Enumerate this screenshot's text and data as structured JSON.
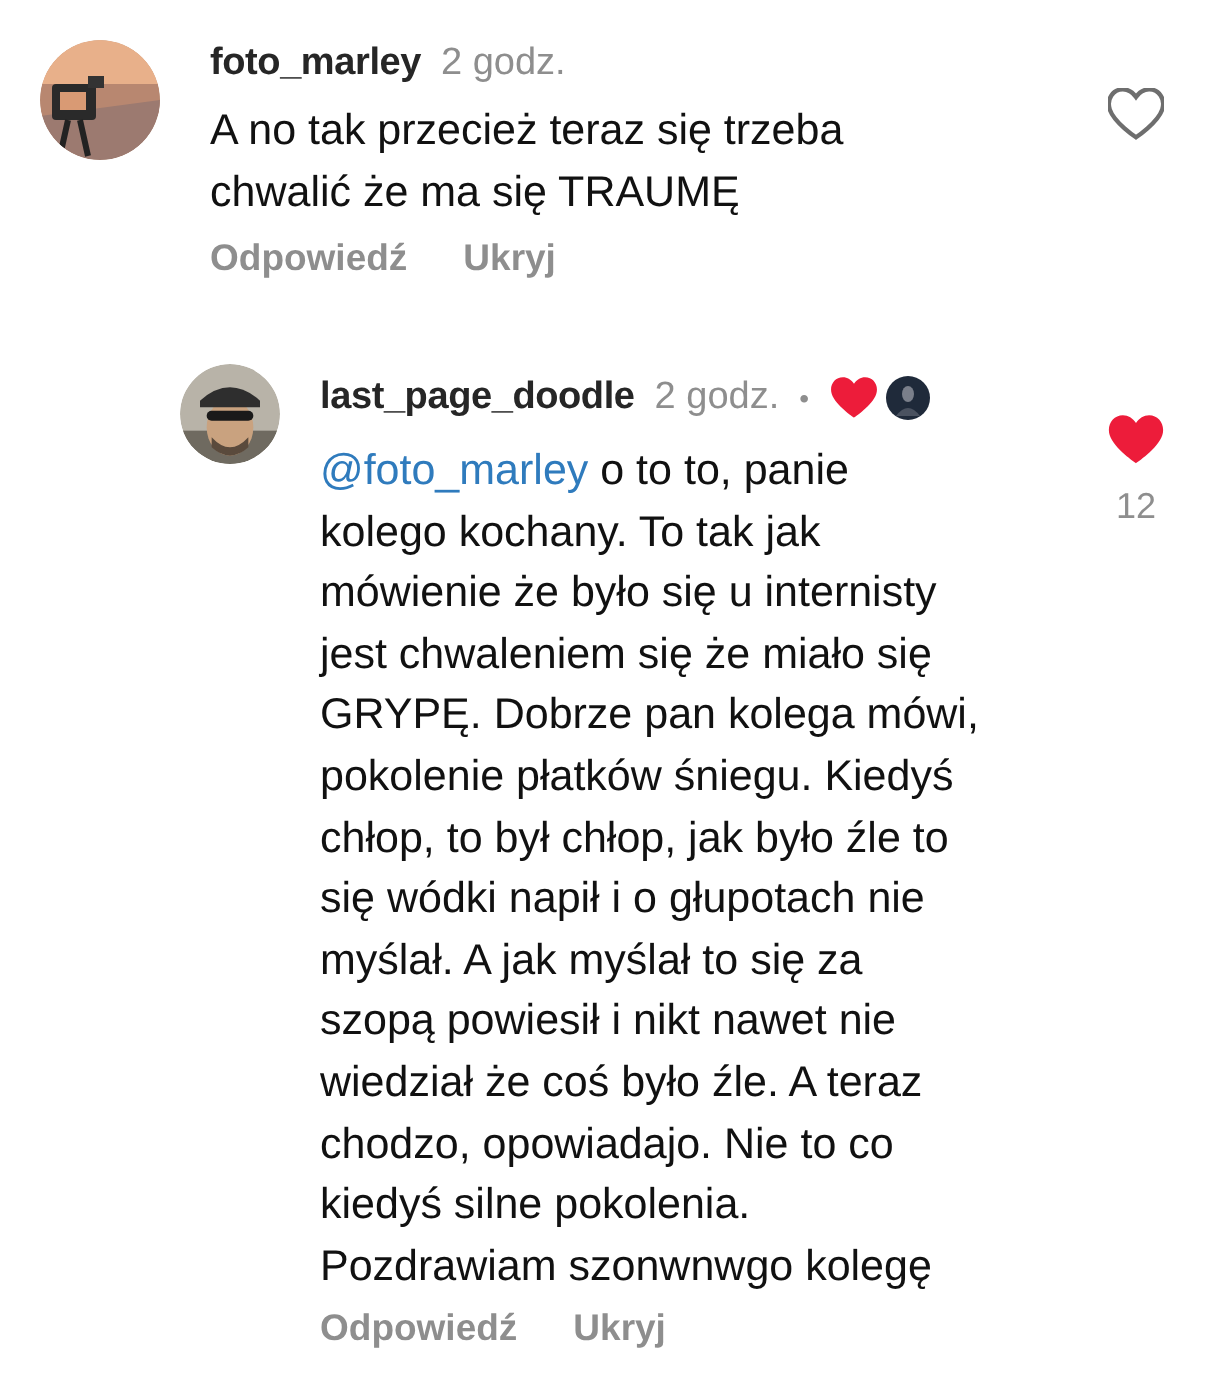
{
  "comments": [
    {
      "author": "foto_marley",
      "time": "2 godz.",
      "lines": [
        "A no tak przecież teraz się trzeba",
        "chwalić że ma się TRAUMĘ"
      ],
      "liked": false,
      "actions": [
        "Odpowiedź",
        "Ukryj"
      ],
      "avatar": {
        "kind": "picture"
      },
      "children": [
        {
          "author": "last_page_doodle",
          "time": "2 godz.",
          "separator": "•",
          "creator_liked": true,
          "mention": "@foto_marley",
          "lines": [
            " o to to, panie",
            "kolego kochany. To tak jak",
            "mówienie że było się u internisty",
            "jest chwaleniem się że miało się",
            "GRYPĘ. Dobrze pan kolega mówi,",
            "pokolenie płatków śniegu. Kiedyś",
            "chłop, to był chłop, jak było źle to",
            "się wódki napił i o głupotach nie",
            "myślał. A jak myślał to się za",
            "szopą powiesił i nikt nawet nie",
            "wiedział że coś było źle. A teraz",
            "chodzo, opowiadajo. Nie to co",
            "kiedyś silne pokolenia.",
            "Pozdrawiam szonwnwgo kolegę"
          ],
          "liked": true,
          "like_count": "12",
          "actions": [
            "Odpowiedź",
            "Ukryj"
          ],
          "avatar": {
            "kind": "picture"
          }
        }
      ]
    }
  ]
}
